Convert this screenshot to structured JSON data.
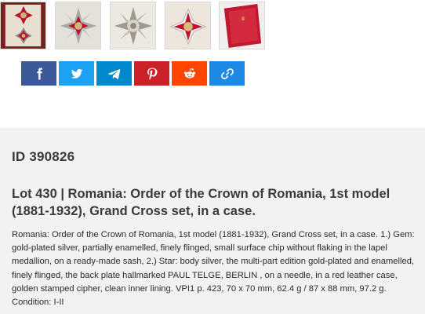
{
  "thumbnails": [
    {
      "name": "thumbnail-set-in-case"
    },
    {
      "name": "thumbnail-star"
    },
    {
      "name": "thumbnail-star-reverse"
    },
    {
      "name": "thumbnail-sash-badge"
    },
    {
      "name": "thumbnail-red-case"
    }
  ],
  "share_buttons": [
    {
      "name": "facebook-share-button",
      "icon": "facebook-icon",
      "color": "#3b5998"
    },
    {
      "name": "twitter-share-button",
      "icon": "twitter-icon",
      "color": "#1da1f2"
    },
    {
      "name": "telegram-share-button",
      "icon": "telegram-icon",
      "color": "#0088cc"
    },
    {
      "name": "pinterest-share-button",
      "icon": "pinterest-icon",
      "color": "#cb2027"
    },
    {
      "name": "reddit-share-button",
      "icon": "reddit-icon",
      "color": "#ff4500"
    },
    {
      "name": "copy-link-button",
      "icon": "link-icon",
      "color": "#1e88e5"
    }
  ],
  "lot": {
    "id_label": "ID 390826",
    "title": "Lot 430 | Romania: Order of the Crown of Romania, 1st model (1881-1932), Grand Cross set, in a case.",
    "description": "Romania: Order of the Crown of Romania, 1st model (1881-1932), Grand Cross set, in a case. 1.) Gem: gold-plated silver, partially enamelled, finely flinged, small surface chip without flaking in the lapel medallion, on a ready-made sash, 2.) Star: body silver, the multi-part edition gold-plated and enamelled, finely flinged, the back plate hallmarked PAUL TELGE, BERLIN , on a needle, in a red leather case, golden stamped cipher, clean inner lining. VPI1 p. 423, 70 x 70 mm, 62.4 g / 87 x 88 mm, 97.2 g. Condition: I-II"
  }
}
